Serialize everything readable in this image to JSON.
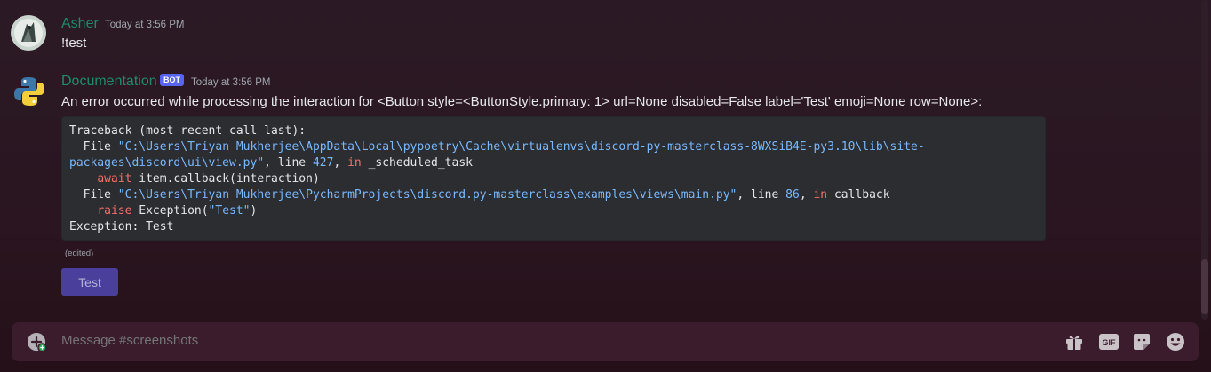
{
  "messages": [
    {
      "username": "Asher",
      "timestamp": "Today at 3:56 PM",
      "text": "!test"
    },
    {
      "username": "Documentation",
      "bot_tag": "BOT",
      "timestamp": "Today at 3:56 PM",
      "text": "An error occurred while processing the interaction for <Button style=<ButtonStyle.primary: 1> url=None disabled=False label='Test' emoji=None row=None>:",
      "code": {
        "l1": "Traceback (most recent call last):",
        "l2a": "  File ",
        "l2b": "\"C:\\Users\\Triyan Mukherjee\\AppData\\Local\\pypoetry\\Cache\\virtualenvs\\discord-py-masterclass-8WXSiB4E-py3.10\\lib\\site-",
        "l3a": "packages\\discord\\ui\\view.py\"",
        "l3b": ", line ",
        "l3c": "427",
        "l3d": ", ",
        "l3e": "in",
        "l3f": " _scheduled_task",
        "l4a": "    ",
        "l4b": "await",
        "l4c": " item.callback(interaction)",
        "l5a": "  File ",
        "l5b": "\"C:\\Users\\Triyan Mukherjee\\PycharmProjects\\discord.py-masterclass\\examples\\views\\main.py\"",
        "l5c": ", line ",
        "l5d": "86",
        "l5e": ", ",
        "l5f": "in",
        "l5g": " callback",
        "l6a": "    ",
        "l6b": "raise",
        "l6c": " Exception(",
        "l6d": "\"Test\"",
        "l6e": ")",
        "l7": "Exception: Test"
      },
      "edited": "(edited)",
      "button_label": "Test"
    }
  ],
  "composer": {
    "placeholder": "Message #screenshots",
    "icons": [
      "add-icon",
      "gift-icon",
      "gif-icon",
      "sticker-icon",
      "emoji-icon"
    ],
    "gif_label": "GIF"
  },
  "colors": {
    "username": "#1f8b6a",
    "bot_tag": "#5865f2",
    "button": "#4a3f9a"
  }
}
